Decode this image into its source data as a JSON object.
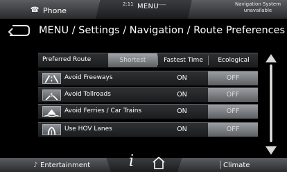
{
  "topbar": {
    "phone_label": "Phone",
    "time": "2:11",
    "menu_label": "MENU",
    "dashes": "----",
    "nav_status_line1": "Navigation System",
    "nav_status_line2": "unavailable"
  },
  "breadcrumb": "MENU / Settings / Navigation / Route Preferences",
  "preferred_route": {
    "label": "Preferred Route",
    "options": [
      "Shortest",
      "Fastest Time",
      "Ecological"
    ],
    "selected": "Shortest"
  },
  "settings": [
    {
      "label": "Avoid Freeways",
      "icon": "freeway-icon",
      "on_label": "ON",
      "off_label": "OFF",
      "value": "OFF"
    },
    {
      "label": "Avoid Tollroads",
      "icon": "tollroad-icon",
      "on_label": "ON",
      "off_label": "OFF",
      "value": "OFF"
    },
    {
      "label": "Avoid Ferries / Car Trains",
      "icon": "ferry-icon",
      "on_label": "ON",
      "off_label": "OFF",
      "value": "OFF"
    },
    {
      "label": "Use HOV Lanes",
      "icon": "hov-lane-icon",
      "on_label": "ON",
      "off_label": "OFF",
      "value": "OFF"
    }
  ],
  "bottombar": {
    "entertainment_label": "Entertainment",
    "info_label": "i",
    "climate_label": "Climate"
  }
}
